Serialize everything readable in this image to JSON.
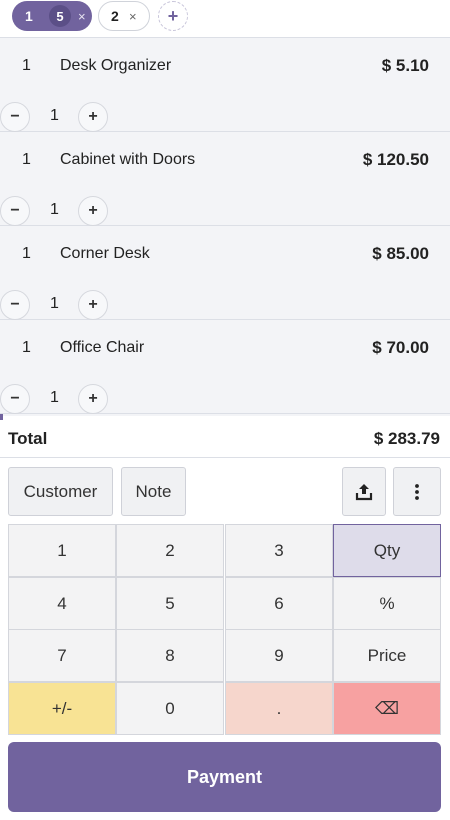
{
  "order_tabs": {
    "active": {
      "number": "1",
      "badge": "5",
      "close": "×"
    },
    "other": {
      "number": "2",
      "close": "×"
    },
    "add": "+"
  },
  "order_lines": [
    {
      "qty": "1",
      "name": "Desk Organizer",
      "price": "$ 5.10",
      "stepper_value": "1"
    },
    {
      "qty": "1",
      "name": "Cabinet with Doors",
      "price": "$ 120.50",
      "stepper_value": "1"
    },
    {
      "qty": "1",
      "name": "Corner Desk",
      "price": "$ 85.00",
      "stepper_value": "1"
    },
    {
      "qty": "1",
      "name": "Office Chair",
      "price": "$ 70.00",
      "stepper_value": "1"
    }
  ],
  "stepper": {
    "minus": "−",
    "plus": "+"
  },
  "total": {
    "label": "Total",
    "value": "$ 283.79"
  },
  "controls": {
    "customer": "Customer",
    "note": "Note",
    "export_icon": "upload-icon",
    "more_icon": "kebab-menu-icon"
  },
  "numpad": {
    "keys": [
      "1",
      "2",
      "3",
      "Qty",
      "4",
      "5",
      "6",
      "%",
      "7",
      "8",
      "9",
      "Price",
      "+/-",
      "0",
      ".",
      "⌫"
    ],
    "selected_mode": "Qty"
  },
  "payment_label": "Payment",
  "colors": {
    "primary": "#71639e",
    "sign_key": "#f8e394",
    "dot_key": "#f6d6cc",
    "backspace_key": "#f7a1a1",
    "qty_key": "#dedcea"
  }
}
